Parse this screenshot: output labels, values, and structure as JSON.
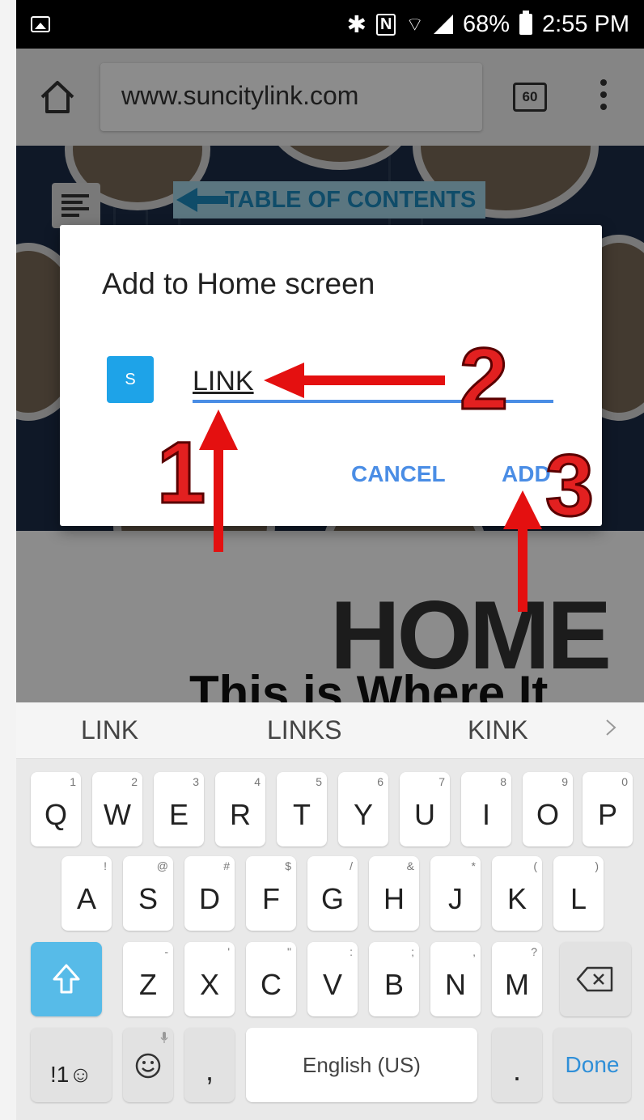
{
  "status_bar": {
    "battery": "68%",
    "time": "2:55 PM"
  },
  "browser": {
    "url": "www.suncitylink.com",
    "tab_count": "60"
  },
  "webpage": {
    "toc_label": "TABLE OF CONTENTS",
    "hero_heading": "HOME",
    "hero_subheading": "This is Where It"
  },
  "dialog": {
    "title": "Add to Home screen",
    "site_icon_letter": "S",
    "name_value": "LINK",
    "cancel_label": "CANCEL",
    "add_label": "ADD"
  },
  "annotations": {
    "step1": "1",
    "step2": "2",
    "step3": "3"
  },
  "suggestions": [
    "LINK",
    "LINKS",
    "KINK"
  ],
  "keyboard": {
    "row1": [
      {
        "key": "Q",
        "hint": "1"
      },
      {
        "key": "W",
        "hint": "2"
      },
      {
        "key": "E",
        "hint": "3"
      },
      {
        "key": "R",
        "hint": "4"
      },
      {
        "key": "T",
        "hint": "5"
      },
      {
        "key": "Y",
        "hint": "6"
      },
      {
        "key": "U",
        "hint": "7"
      },
      {
        "key": "I",
        "hint": "8"
      },
      {
        "key": "O",
        "hint": "9"
      },
      {
        "key": "P",
        "hint": "0"
      }
    ],
    "row2": [
      {
        "key": "A",
        "hint": "!"
      },
      {
        "key": "S",
        "hint": "@"
      },
      {
        "key": "D",
        "hint": "#"
      },
      {
        "key": "F",
        "hint": "$"
      },
      {
        "key": "G",
        "hint": "/"
      },
      {
        "key": "H",
        "hint": "&"
      },
      {
        "key": "J",
        "hint": "*"
      },
      {
        "key": "K",
        "hint": "("
      },
      {
        "key": "L",
        "hint": ")"
      }
    ],
    "row3": [
      {
        "key": "Z",
        "hint": "-"
      },
      {
        "key": "X",
        "hint": "'"
      },
      {
        "key": "C",
        "hint": "\""
      },
      {
        "key": "V",
        "hint": ":"
      },
      {
        "key": "B",
        "hint": ";"
      },
      {
        "key": "N",
        "hint": ","
      },
      {
        "key": "M",
        "hint": "?"
      }
    ],
    "symbols_key": "!1☺",
    "comma_key": ",",
    "space_label": "English (US)",
    "period_key": ".",
    "done_label": "Done"
  }
}
